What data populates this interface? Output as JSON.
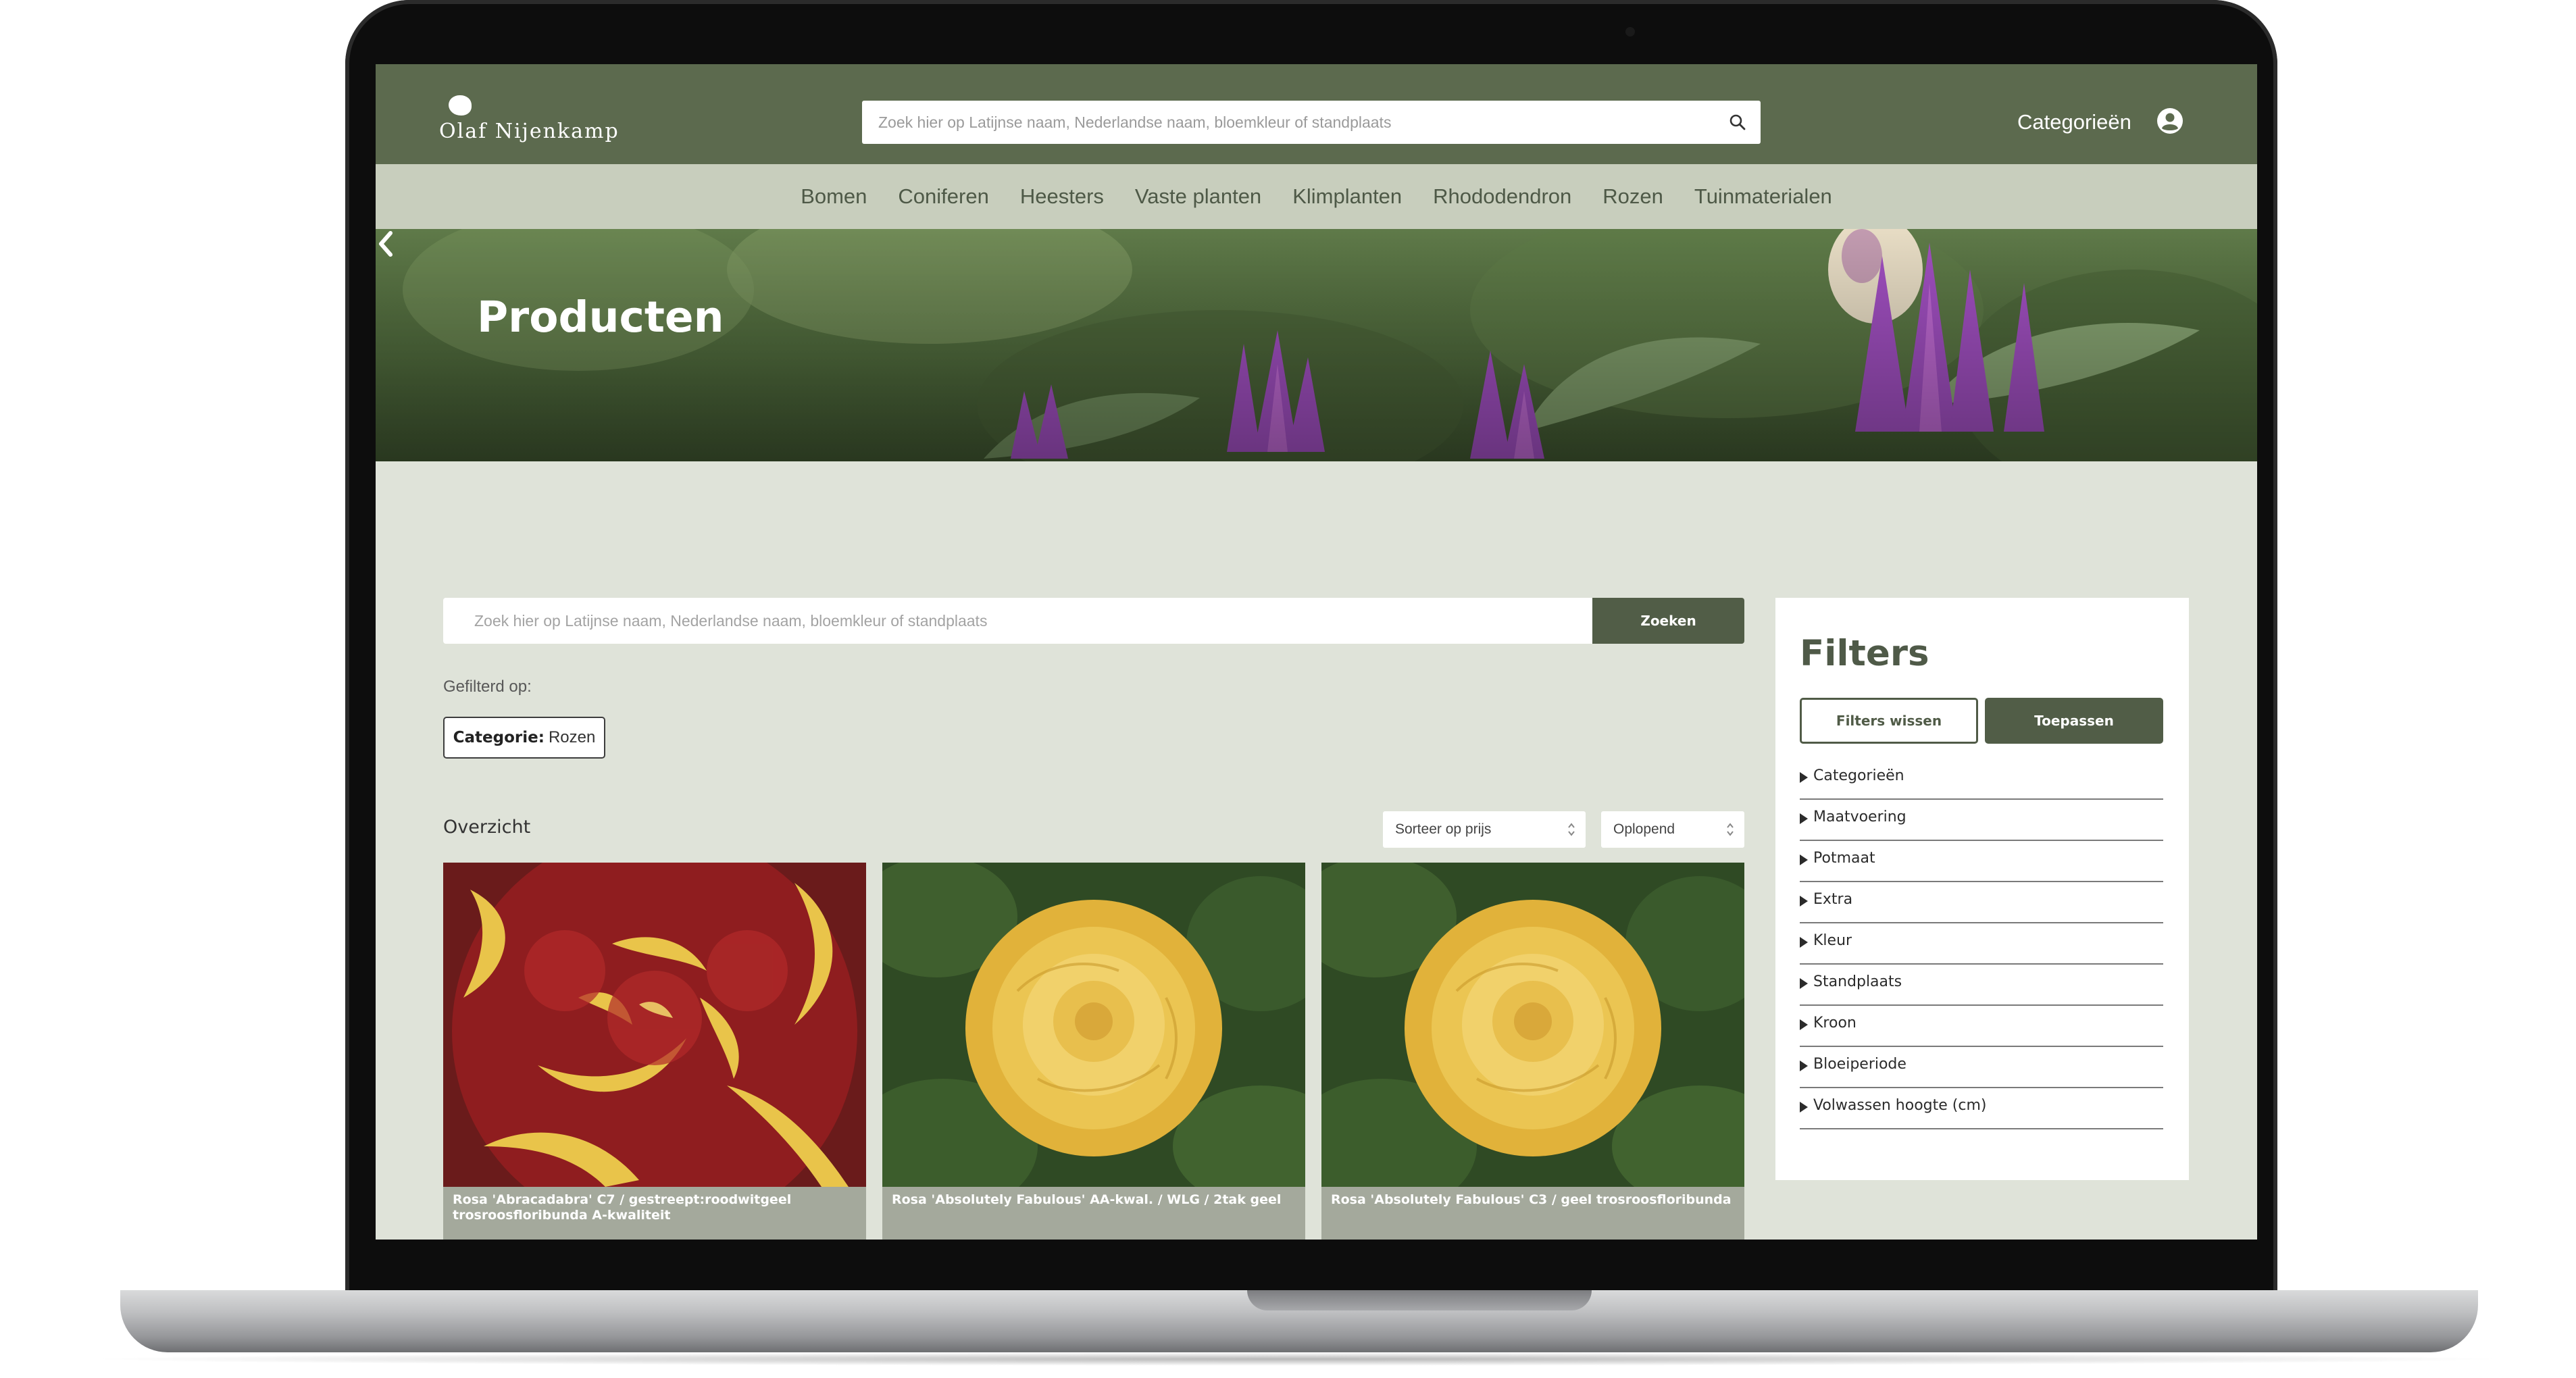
{
  "header": {
    "logo_text": "Olaf Nijenkamp",
    "search_placeholder": "Zoek hier op Latijnse naam, Nederlandse naam, bloemkleur of standplaats",
    "categories_label": "Categorieën"
  },
  "nav": {
    "items": [
      "Bomen",
      "Coniferen",
      "Heesters",
      "Vaste planten",
      "Klimplanten",
      "Rhododendron",
      "Rozen",
      "Tuinmaterialen"
    ]
  },
  "hero": {
    "title": "Producten"
  },
  "search": {
    "placeholder": "Zoek hier op Latijnse naam, Nederlandse naam, bloemkleur of standplaats",
    "button_label": "Zoeken"
  },
  "filters_applied": {
    "label": "Gefilterd op:",
    "chip_key": "Categorie:",
    "chip_value": "Rozen"
  },
  "overview": {
    "title": "Overzicht",
    "sort_value": "Sorteer op prijs",
    "order_value": "Oplopend"
  },
  "products": [
    {
      "name": "Rosa 'Abracadabra' C7 / gestreept:roodwitgeel trosroosfloribunda A-kwaliteit"
    },
    {
      "name": "Rosa 'Absolutely Fabulous' AA-kwal. / WLG / 2tak geel"
    },
    {
      "name": "Rosa 'Absolutely Fabulous' C3 / geel trosroosfloribunda"
    }
  ],
  "filter_panel": {
    "title": "Filters",
    "clear_label": "Filters wissen",
    "apply_label": "Toepassen",
    "groups": [
      "Categorieën",
      "Maatvoering",
      "Potmaat",
      "Extra",
      "Kleur",
      "Standplaats",
      "Kroon",
      "Bloeiperiode",
      "Volwassen hoogte (cm)"
    ]
  },
  "colors": {
    "header_green": "#5c6a4e",
    "nav_bg": "#c8cebd",
    "page_bg": "#dfe3d9",
    "button_green": "#515d47"
  }
}
